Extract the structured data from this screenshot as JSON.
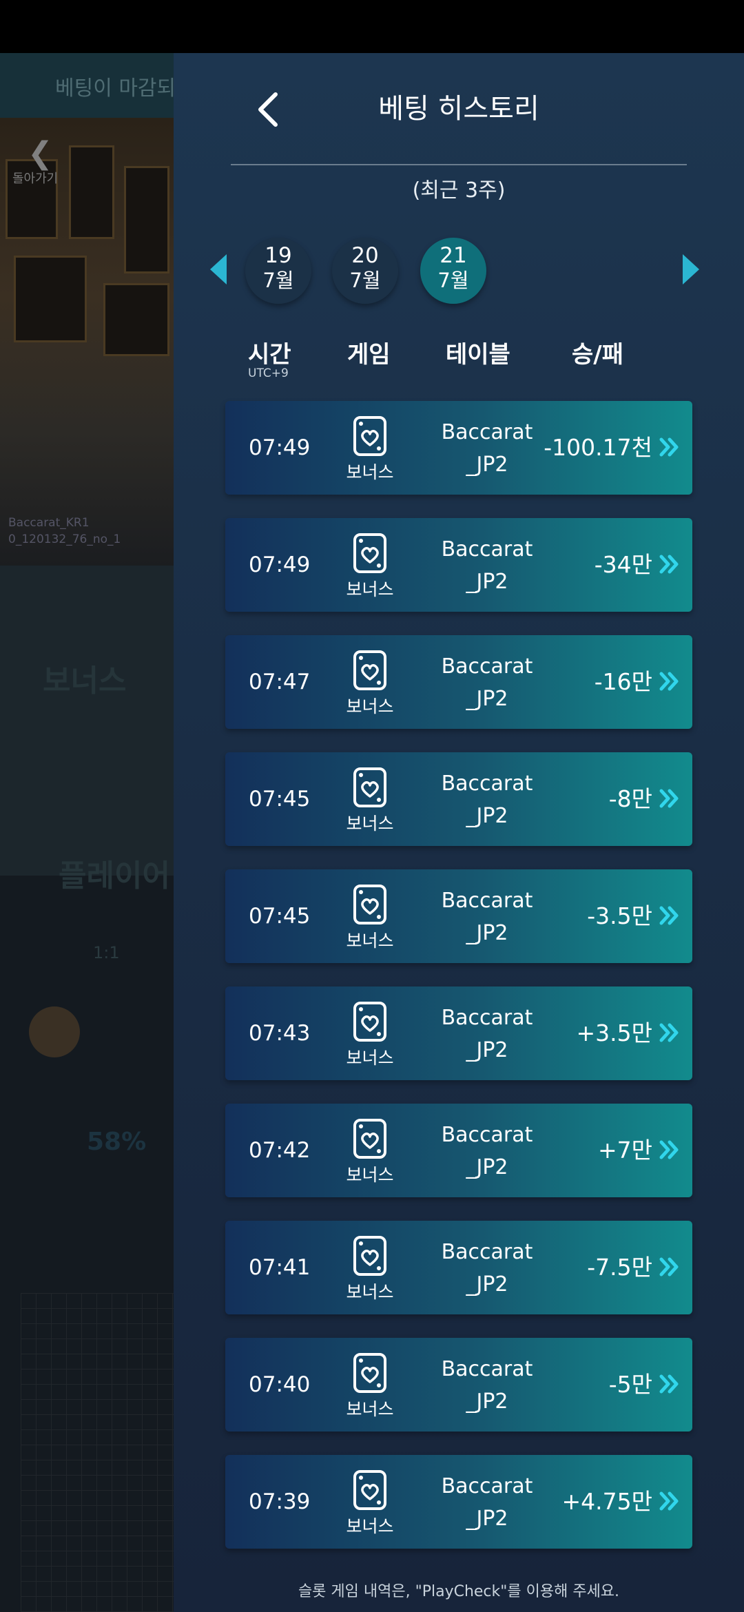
{
  "background": {
    "notice": "베팅이 마감되",
    "back_label": "돌아가기",
    "video_label_line1": "Baccarat_KR1",
    "video_label_line2": "0_120132_76_no_1",
    "bonus_label": "보너스",
    "player_label": "플레이어",
    "ratio": "1:1",
    "percent": "58%"
  },
  "header": {
    "title": "베팅 히스토리",
    "subtitle": "(최근 3주)"
  },
  "dates": [
    {
      "day": "19",
      "month": "7월",
      "selected": false
    },
    {
      "day": "20",
      "month": "7월",
      "selected": false
    },
    {
      "day": "21",
      "month": "7월",
      "selected": true
    }
  ],
  "columns": {
    "time": "시간",
    "timezone": "UTC+9",
    "game": "게임",
    "table": "테이블",
    "result": "승/패"
  },
  "rows": [
    {
      "time": "07:49",
      "game": "보너스",
      "table_line1": "Baccarat",
      "table_line2": "_JP2",
      "result": "-100.17천"
    },
    {
      "time": "07:49",
      "game": "보너스",
      "table_line1": "Baccarat",
      "table_line2": "_JP2",
      "result": "-34만"
    },
    {
      "time": "07:47",
      "game": "보너스",
      "table_line1": "Baccarat",
      "table_line2": "_JP2",
      "result": "-16만"
    },
    {
      "time": "07:45",
      "game": "보너스",
      "table_line1": "Baccarat",
      "table_line2": "_JP2",
      "result": "-8만"
    },
    {
      "time": "07:45",
      "game": "보너스",
      "table_line1": "Baccarat",
      "table_line2": "_JP2",
      "result": "-3.5만"
    },
    {
      "time": "07:43",
      "game": "보너스",
      "table_line1": "Baccarat",
      "table_line2": "_JP2",
      "result": "+3.5만"
    },
    {
      "time": "07:42",
      "game": "보너스",
      "table_line1": "Baccarat",
      "table_line2": "_JP2",
      "result": "+7만"
    },
    {
      "time": "07:41",
      "game": "보너스",
      "table_line1": "Baccarat",
      "table_line2": "_JP2",
      "result": "-7.5만"
    },
    {
      "time": "07:40",
      "game": "보너스",
      "table_line1": "Baccarat",
      "table_line2": "_JP2",
      "result": "-5만"
    },
    {
      "time": "07:39",
      "game": "보너스",
      "table_line1": "Baccarat",
      "table_line2": "_JP2",
      "result": "+4.75만"
    }
  ],
  "footer": "슬롯 게임 내역은, \"PlayCheck\"를 이용해 주세요.",
  "colors": {
    "accent": "#2bb6d2",
    "selected_date": "#0f6f7a",
    "row_start": "#13305a",
    "row_end": "#128b8d"
  }
}
